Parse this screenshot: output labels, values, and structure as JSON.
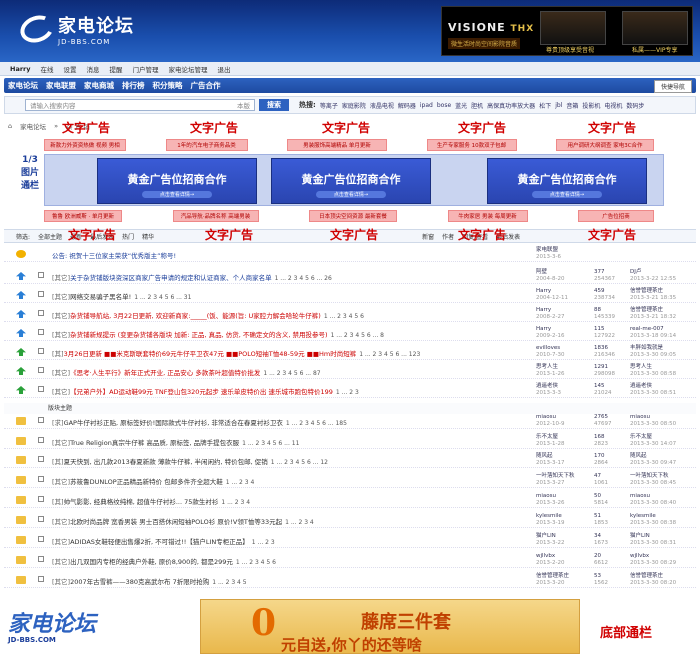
{
  "header": {
    "logo_text": "家电论坛",
    "logo_url": "JD-BBS.COM",
    "topad": {
      "brand": "VISIONE",
      "brand2": "THX",
      "sub": "微生活时尚空间影院音质",
      "cap1": "尊贵顶级享受音视",
      "cap2": "私属——VIP专享"
    }
  },
  "userbar": {
    "user": "Harry",
    "items": [
      "在线",
      "设置",
      "消息",
      "提醒",
      "门户管理",
      "家电论坛管理",
      "退出"
    ]
  },
  "nav": {
    "items": [
      "家电论坛",
      "家电联盟",
      "家电商城",
      "排行榜",
      "积分策略",
      "广告合作"
    ],
    "quick": "快捷导航"
  },
  "search": {
    "placeholder": "请输入搜索内容",
    "scope": "本版",
    "button": "搜索",
    "hot_label": "热搜:",
    "hot": [
      "等离子",
      "家庭影院",
      "液晶电视",
      "解码器",
      "ipad",
      "bose",
      "蓝光",
      "胆机",
      "高保真功率放大器",
      "松下",
      "jbl",
      "音箱",
      "投影机",
      "电视机",
      "数码步"
    ]
  },
  "crumb": {
    "home": "家电论坛",
    "sep": "»",
    "forum": "杂 货 铺"
  },
  "textad": "文字广告",
  "adstrip1": [
    "新款力外资资热做 视频 男相",
    "1年的汽车电子商务品类",
    "男装服饰高端精品 单月更新",
    "生产专家服务 10款双子包邮",
    "用户调研大纲调查 家电3C合作"
  ],
  "adstrip2": [
    "鲁鲁 欧洲威斯 · 单月更新",
    "汽品导航·品牌名称 高端男装",
    "日本顶尖空间资源 最新套餐",
    "牛肉家居 男装 每周更新",
    "广告位招商"
  ],
  "carousel": {
    "count": "1/3",
    "line1": "图片",
    "line2": "通栏"
  },
  "gold": {
    "title": "黄金广告位招商合作",
    "link": "点击查看详情→"
  },
  "filter": {
    "items": [
      "筛选:",
      "全部主题",
      "最新",
      "最后发表",
      "热门",
      "精华"
    ],
    "right": [
      "新窗",
      "作者",
      "回复/查看",
      "最后发表"
    ]
  },
  "section_label": "版块主题",
  "rows": [
    {
      "icon": "speaker",
      "tag": "",
      "title": "公告: 祝贺十三位家主荣获“优秀版主”称号!",
      "author": "家电联盟",
      "date": "2013-3-6",
      "n1": "",
      "n2": "",
      "last": "",
      "ldate": ""
    },
    {
      "icon": "up",
      "tag": "[其它]",
      "title": "关于杂货铺版块资深区商家广告申请的规定和认证商家、个人商家名单",
      "pages": "1 ... 2 3 4 5 6 ... 26",
      "author": "阿壁",
      "date": "2004-8-20",
      "n1": "377",
      "n2": "254367",
      "last": "DJ卢",
      "ldate": "2013-3-22 12:55"
    },
    {
      "icon": "up",
      "tag": "[其它]",
      "title": "网络交易骗子黑名单!",
      "pages": "1 ... 2 3 4 5 6 ... 31",
      "author": "Harry",
      "date": "2004-12-11",
      "n1": "459",
      "n2": "238734",
      "last": "信誉管理茶庄",
      "ldate": "2013-3-21 18:35"
    },
    {
      "icon": "up",
      "tag": "[其它]",
      "title": "杂货铺导航站, 3月22日更新, 欢迎新商家:_____(饭、能源(旨: U家腔力解会哈轮牛仔裤)",
      "pages": "1 ... 2 3 4 5 6",
      "author": "Harry",
      "date": "2008-2-27",
      "n1": "88",
      "n2": "145339",
      "last": "信誉管理茶庄",
      "ldate": "2013-3-21 18:32"
    },
    {
      "icon": "up",
      "tag": "[其它]",
      "title": "杂货铺新规提示 (变更杂货铺各版块 加新: 正品, 真品, 仿货, 不确定文的含义, 禁用投参号)",
      "pages": "1 ... 2 3 4 5 6 ... 8",
      "author": "Harry",
      "date": "2009-2-16",
      "n1": "115",
      "n2": "127922",
      "last": "real-me-007",
      "ldate": "2013-3-18 09:14"
    },
    {
      "icon": "upg",
      "tag": "[其]",
      "title": "3月26日更新 ■■米克斯联套特价69元牛仔平卫衣47元 ■■POLO短袖T恤48-59元 ■■Hm时尚短裤",
      "pages": "1 ... 2 3 4 5 6 ... 123",
      "author": "evilloves",
      "date": "2010-7-30",
      "n1": "1836",
      "n2": "216346",
      "last": "丰胖如我就是",
      "ldate": "2013-3-30 09:05"
    },
    {
      "icon": "upg",
      "tag": "[其它]",
      "title": "《思考·人生平行》新年正式开业, 正品安心 多款茶叶超值特价批发",
      "pages": "1 ... 2 3 4 5 6 ... 87",
      "author": "思考人生",
      "date": "2013-1-26",
      "n1": "1291",
      "n2": "298098",
      "last": "思考人生",
      "ldate": "2013-3-30 08:58"
    },
    {
      "icon": "upg",
      "tag": "[其它]",
      "title": "【兄弟户外】AD运动鞋99元 TNF登山包320元起步 速乐单皮特价出 速乐城市跑包特价199",
      "pages": "1 ... 2 3",
      "author": "逍遥老侠",
      "date": "2013-3-3",
      "n1": "145",
      "n2": "21024",
      "last": "逍遥老侠",
      "ldate": "2013-3-30 08:51"
    },
    {
      "icon": "fold",
      "tag": "[求]",
      "title": "GAP牛仔衬衫正贴, 原标签好价!国际款式牛仔衬衫, 非常适合在春夏衬衫卫衣",
      "pages": "1 ... 2 3 4 5 6 ... 185",
      "author": "miaosu",
      "date": "2012-10-9",
      "n1": "2765",
      "n2": "47697",
      "last": "miaosu",
      "ldate": "2013-3-30 08:50"
    },
    {
      "icon": "fold",
      "tag": "[其它]",
      "title": "True Religion真宗牛仔裤 高品质, 原标签, 品牌手提包衣服",
      "pages": "1 ... 2 3 4 5 6 ... 11",
      "author": "乐不太屋",
      "date": "2013-1-28",
      "n1": "168",
      "n2": "2823",
      "last": "乐不太屋",
      "ldate": "2013-3-30 14:07"
    },
    {
      "icon": "fold",
      "tag": "[其]",
      "title": "夏天快到, 出几款2013春夏新款 薄款牛仔裤, 半闲闲约, 特价包邮, 促销",
      "pages": "1 ... 2 3 4 5 6 ... 12",
      "author": "随风起",
      "date": "2013-3-17",
      "n1": "170",
      "n2": "2864",
      "last": "随风起",
      "ldate": "2013-3-30 09:47"
    },
    {
      "icon": "fold",
      "tag": "[其它]",
      "title": "苏筱鲁DUNLOP正品精品新特价 包邮多件齐全超大鞋",
      "pages": "1 ... 2 3 4",
      "author": "一叶落知天下秋",
      "date": "2013-3-27",
      "n1": "47",
      "n2": "1061",
      "last": "一叶落知天下秋",
      "ldate": "2013-3-30 08:45"
    },
    {
      "icon": "fold",
      "tag": "[其]",
      "title": "帅气影影, 经典格纹纯棉, 超值牛仔衬衫... 75款生衬衫",
      "pages": "1 ... 2 3 4",
      "author": "miaosu",
      "date": "2013-3-26",
      "n1": "50",
      "n2": "5814",
      "last": "miaosu",
      "ldate": "2013-3-30 08:40"
    },
    {
      "icon": "fold",
      "tag": "[其它]",
      "title": "北欧时尚品牌 宽香男装 男士百搭休闲短袖POLO衫 原价!V领T恤等33元起",
      "pages": "1 ... 2 3 4",
      "author": "kylesmile",
      "date": "2013-3-19",
      "n1": "51",
      "n2": "1853",
      "last": "kylesmile",
      "ldate": "2013-3-30 08:38"
    },
    {
      "icon": "fold",
      "tag": "[其它]",
      "title": "ADIDAS女鞋轻便出售爆2折, 不可错过!!【猫户LIN专柜正品】",
      "pages": "1 ... 2 3",
      "author": "猫户LIN",
      "date": "2013-3-22",
      "n1": "34",
      "n2": "1673",
      "last": "猫户LIN",
      "ldate": "2013-3-30 08:31"
    },
    {
      "icon": "fold",
      "tag": "[其它]",
      "title": "出几双国内专柜的经典户外鞋, 原价8,900的, 都是299元",
      "pages": "1 ... 2 3 4 5 6",
      "author": "wjllvbx",
      "date": "2013-2-20",
      "n1": "20",
      "n2": "6612",
      "last": "wjllvbx",
      "ldate": "2013-3-30 08:29"
    },
    {
      "icon": "fold",
      "tag": "[其它]",
      "title": "2007年古雪裤——380克高武尔布 7折限时抢购",
      "pages": "1 ... 2 3 4 5",
      "author": "信誉管理茶庄",
      "date": "2013-3-20",
      "n1": "53",
      "n2": "1562",
      "last": "信誉管理茶庄",
      "ldate": "2013-3-30 08:20"
    }
  ],
  "bottom": {
    "logo": "家电论坛",
    "url": "JD-BBS.COM",
    "zero": "0",
    "big": "藤席三件套",
    "mid": "元自送,你丫的还等啥",
    "right": "底部通栏"
  }
}
